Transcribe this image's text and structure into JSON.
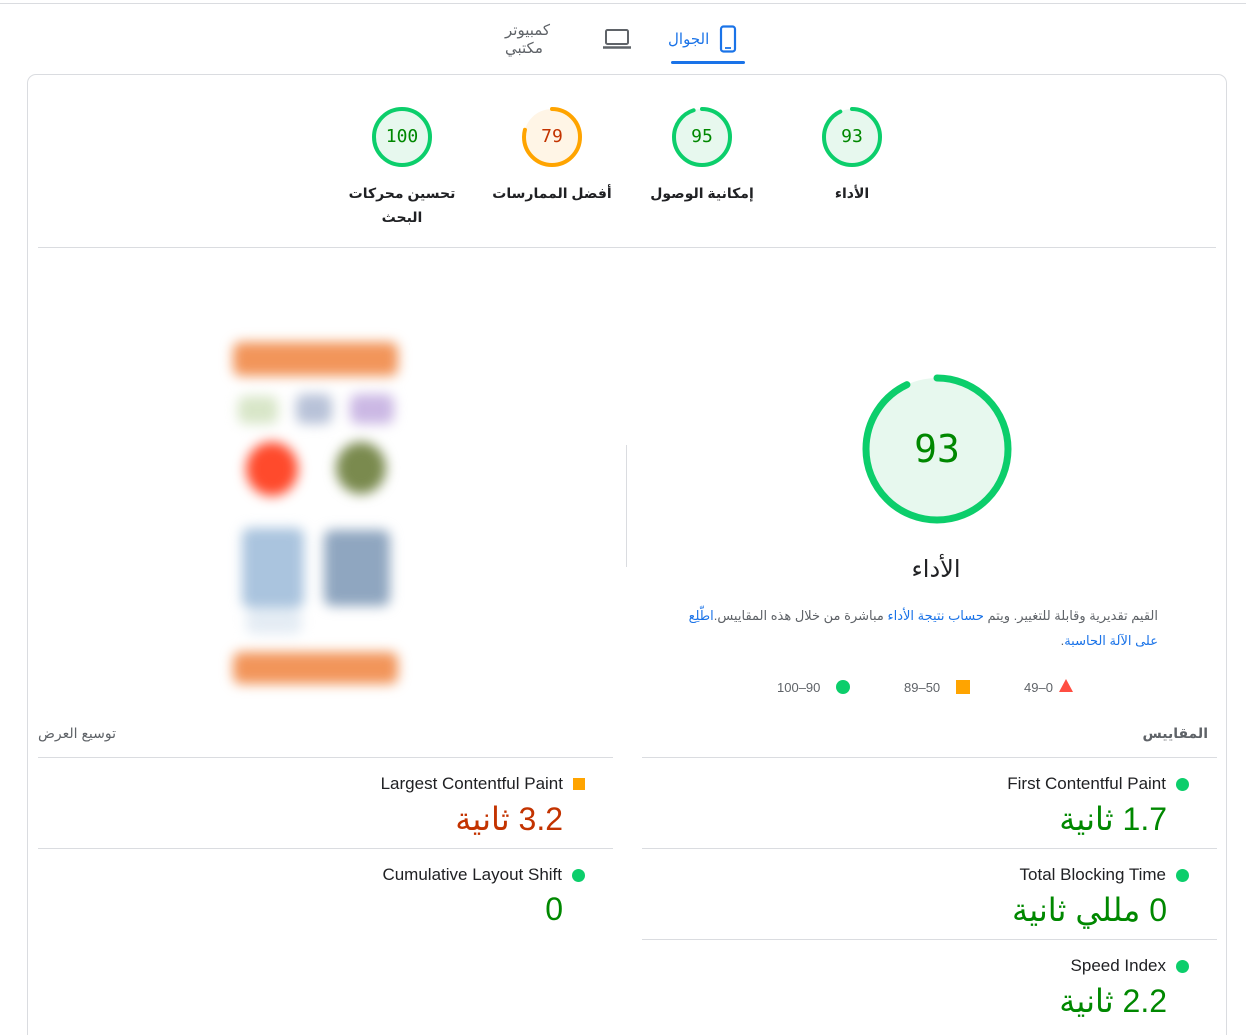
{
  "tabs": {
    "mobile": "الجوال",
    "desktop": "كمبيوتر مكتبي"
  },
  "gauges": [
    {
      "score": "93",
      "label": "الأداء"
    },
    {
      "score": "95",
      "label": "إمكانية الوصول"
    },
    {
      "score": "79",
      "label": "أفضل الممارسات"
    },
    {
      "score": "100",
      "label_line1": "تحسين محركات",
      "label_line2": "البحث"
    }
  ],
  "gauge_levels": [
    0.93,
    0.95,
    0.79,
    1.0
  ],
  "performance": {
    "score": "93",
    "title": "الأداء",
    "desc_part1": "القيم تقديرية وقابلة للتغيير. ويتم ",
    "desc_link1": "حساب نتيجة الأداء",
    "desc_part2": " مباشرة من خلال هذه المقاييس.",
    "desc_link2": "اطّلِع على الآلة الحاسبة",
    "desc_end": "."
  },
  "legend": {
    "red": "49–0",
    "orange": "89–50",
    "green": "100–90"
  },
  "metrics_header": {
    "title": "المقاييس",
    "expand": "توسيع العرض"
  },
  "metrics": {
    "fcp": {
      "name": "First Contentful Paint",
      "value": "1.7 ثانية"
    },
    "lcp": {
      "name": "Largest Contentful Paint",
      "value": "3.2 ثانية"
    },
    "tbt": {
      "name": "Total Blocking Time",
      "value": "0 مللي ثانية"
    },
    "cls": {
      "name": "Cumulative Layout Shift",
      "value": "0"
    },
    "si": {
      "name": "Speed Index",
      "value": "2.2 ثانية"
    }
  },
  "colors": {
    "accent": "#1a73e8",
    "pass": "#0cce6b",
    "average": "#ffa400",
    "fail": "#ff4e42",
    "pass_text": "#008800",
    "average_text": "#c33300"
  }
}
